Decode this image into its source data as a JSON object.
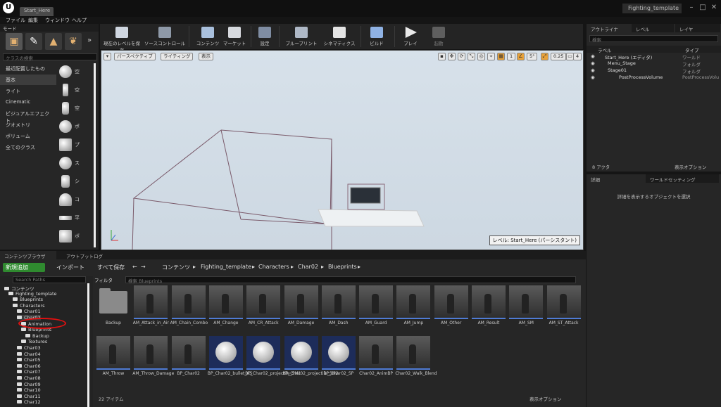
{
  "title_bar": {
    "tab": "Start_Here",
    "project": "Fighting_template"
  },
  "menu": [
    "ファイル",
    "編集",
    "ウィンドウ",
    "ヘルプ"
  ],
  "modes": {
    "title": "モード",
    "search_placeholder": "クラスの検索",
    "categories": [
      "最近配置したもの",
      "基本",
      "ライト",
      "Cinematic",
      "ビジュアルエフェクト",
      "ジオメトリ",
      "ボリューム",
      "全てのクラス"
    ],
    "selected_category": "基本",
    "items": [
      "空",
      "空",
      "空",
      "ポ",
      "プ",
      "ス",
      "シ",
      "コ",
      "平",
      "ボ"
    ]
  },
  "toolbar": [
    "現在のレベルを保存",
    "ソースコントロール",
    "コンテンツ",
    "マーケット",
    "設定",
    "ブループリント",
    "シネマティクス",
    "ビルド",
    "プレイ",
    "起動"
  ],
  "viewport": {
    "perspective": "パースペクティブ",
    "lighting": "ライティング",
    "show": "表示",
    "snap_angle": "5°",
    "snap_scale": "0.25",
    "camera_speed": "4",
    "grid_size": "1",
    "level_label": "レベル: Start_Here (パーシスタント)"
  },
  "outliner": {
    "tabs": [
      "アウトライナ",
      "レベル",
      "レイヤ"
    ],
    "search_placeholder": "検索",
    "col_label": "ラベル",
    "col_type": "タイプ",
    "rows": [
      {
        "label": "Start_Here (エディタ)",
        "type": "ワールド"
      },
      {
        "label": "Menu_Stage",
        "type": "フォルダ"
      },
      {
        "label": "Stage01",
        "type": "フォルダ"
      },
      {
        "label": "PostProcessVolume",
        "type": "PostProcessVolu"
      }
    ],
    "actor_count": "8 アクタ",
    "view_options": "表示オプション"
  },
  "details": {
    "tabs": [
      "詳細",
      "ワールドセッティング"
    ],
    "message": "詳細を表示するオブジェクトを選択"
  },
  "content_browser": {
    "tabs": [
      "コンテンツブラウザ",
      "アウトプットログ"
    ],
    "add_new": "新規追加",
    "import": "インポート",
    "save_all": "すべて保存",
    "breadcrumb": [
      "コンテンツ",
      "Fighting_template",
      "Characters",
      "Char02",
      "Blueprints"
    ],
    "tree_search_placeholder": "Search Paths",
    "tree": [
      {
        "label": "コンテンツ",
        "depth": 0
      },
      {
        "label": "Fighting_template",
        "depth": 1
      },
      {
        "label": "Blueprints",
        "depth": 2
      },
      {
        "label": "Characters",
        "depth": 2
      },
      {
        "label": "Char01",
        "depth": 3
      },
      {
        "label": "Char02",
        "depth": 3
      },
      {
        "label": "Animation",
        "depth": 4
      },
      {
        "label": "Blueprints",
        "depth": 4
      },
      {
        "label": "Backup",
        "depth": 5
      },
      {
        "label": "Textures",
        "depth": 4
      },
      {
        "label": "Char03",
        "depth": 3
      },
      {
        "label": "Char04",
        "depth": 3
      },
      {
        "label": "Char05",
        "depth": 3
      },
      {
        "label": "Char06",
        "depth": 3
      },
      {
        "label": "Char07",
        "depth": 3
      },
      {
        "label": "Char08",
        "depth": 3
      },
      {
        "label": "Char09",
        "depth": 3
      },
      {
        "label": "Char10",
        "depth": 3
      },
      {
        "label": "Char11",
        "depth": 3
      },
      {
        "label": "Char12",
        "depth": 3
      }
    ],
    "filter": "フィルタ",
    "search_placeholder": "検索 Blueprints",
    "assets": [
      {
        "name": "Backup",
        "kind": "folder"
      },
      {
        "name": "AM_Attack_in_Air",
        "kind": "anim"
      },
      {
        "name": "AM_Chain_Combo",
        "kind": "anim"
      },
      {
        "name": "AM_Change",
        "kind": "anim"
      },
      {
        "name": "AM_CR_Attack",
        "kind": "anim"
      },
      {
        "name": "AM_Damage",
        "kind": "anim"
      },
      {
        "name": "AM_Dash",
        "kind": "anim"
      },
      {
        "name": "AM_Guard",
        "kind": "anim"
      },
      {
        "name": "AM_Jump",
        "kind": "anim"
      },
      {
        "name": "AM_Other",
        "kind": "anim"
      },
      {
        "name": "AM_Result",
        "kind": "anim"
      },
      {
        "name": "AM_SM",
        "kind": "anim"
      },
      {
        "name": "AM_ST_Attack",
        "kind": "anim"
      },
      {
        "name": "AM_Throw",
        "kind": "anim"
      },
      {
        "name": "AM_Throw_Damage",
        "kind": "anim"
      },
      {
        "name": "BP_Char02",
        "kind": "anim"
      },
      {
        "name": "BP_Char02_bullet_AS",
        "kind": "ball"
      },
      {
        "name": "BP_Char02_projectile_SM1",
        "kind": "ball"
      },
      {
        "name": "BP_Char02_projectile_SM2",
        "kind": "ball"
      },
      {
        "name": "BP_Char02_SP",
        "kind": "ball"
      },
      {
        "name": "Char02_AnimBP",
        "kind": "anim"
      },
      {
        "name": "Char02_Walk_Blend",
        "kind": "anim"
      }
    ],
    "item_count": "22 アイテム",
    "view_options": "表示オプション"
  }
}
